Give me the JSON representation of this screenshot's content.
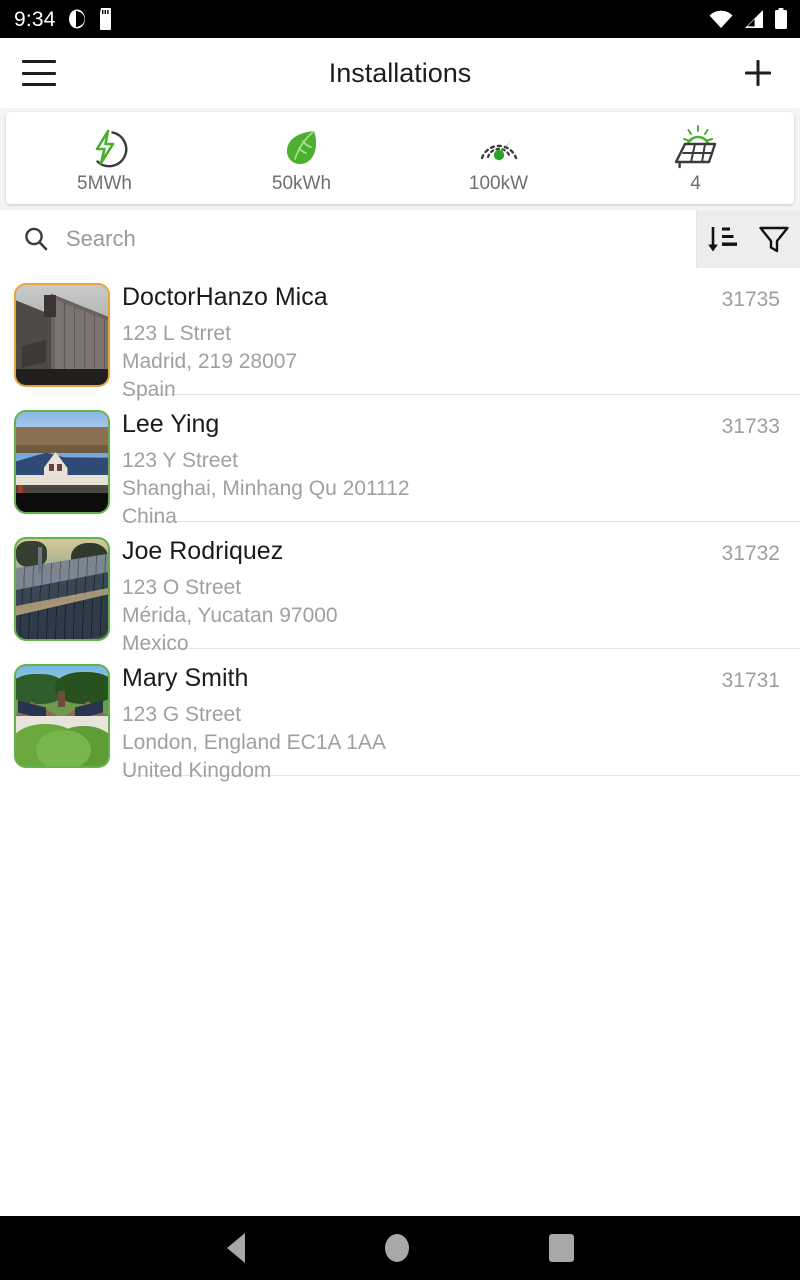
{
  "status_bar": {
    "time": "9:34",
    "icons_left": [
      "app-notification-icon",
      "sd-card-icon"
    ],
    "icons_right": [
      "wifi-icon",
      "cellular-signal-icon",
      "battery-icon"
    ]
  },
  "app_bar": {
    "menu_icon": "hamburger-menu-icon",
    "title": "Installations",
    "add_icon": "plus-icon"
  },
  "stats": {
    "items": [
      {
        "icon": "energy-bolt-icon",
        "label": "5MWh"
      },
      {
        "icon": "leaf-icon",
        "label": "50kWh"
      },
      {
        "icon": "gauge-icon",
        "label": "100kW"
      },
      {
        "icon": "solar-panel-icon",
        "label": "4"
      }
    ]
  },
  "search": {
    "icon": "search-icon",
    "placeholder": "Search",
    "value": "",
    "sort_icon": "sort-descending-icon",
    "filter_icon": "filter-funnel-icon"
  },
  "colors": {
    "accent_green": "#4caf2f",
    "border_green": "#63b34c",
    "border_amber": "#e8a33d",
    "text_primary": "#1b1b1b",
    "text_muted": "#a0a0a0"
  },
  "list": {
    "rows": [
      {
        "name": "DoctorHanzo Mica",
        "id": "31735",
        "street": "123 L Strret",
        "city_line": "Madrid, 219 28007",
        "country": "Spain",
        "thumb_border": "amber"
      },
      {
        "name": "Lee Ying",
        "id": "31733",
        "street": "123 Y Street",
        "city_line": "Shanghai, Minhang Qu 201112",
        "country": "China",
        "thumb_border": "green"
      },
      {
        "name": "Joe Rodriquez",
        "id": "31732",
        "street": "123 O Street",
        "city_line": "Mérida, Yucatan 97000",
        "country": "Mexico",
        "thumb_border": "green"
      },
      {
        "name": "Mary Smith",
        "id": "31731",
        "street": "123 G Street",
        "city_line": "London, England EC1A 1AA",
        "country": "United Kingdom",
        "thumb_border": "green"
      }
    ]
  },
  "nav_bar": {
    "back": "back-triangle-icon",
    "home": "home-circle-icon",
    "recents": "recents-square-icon"
  }
}
